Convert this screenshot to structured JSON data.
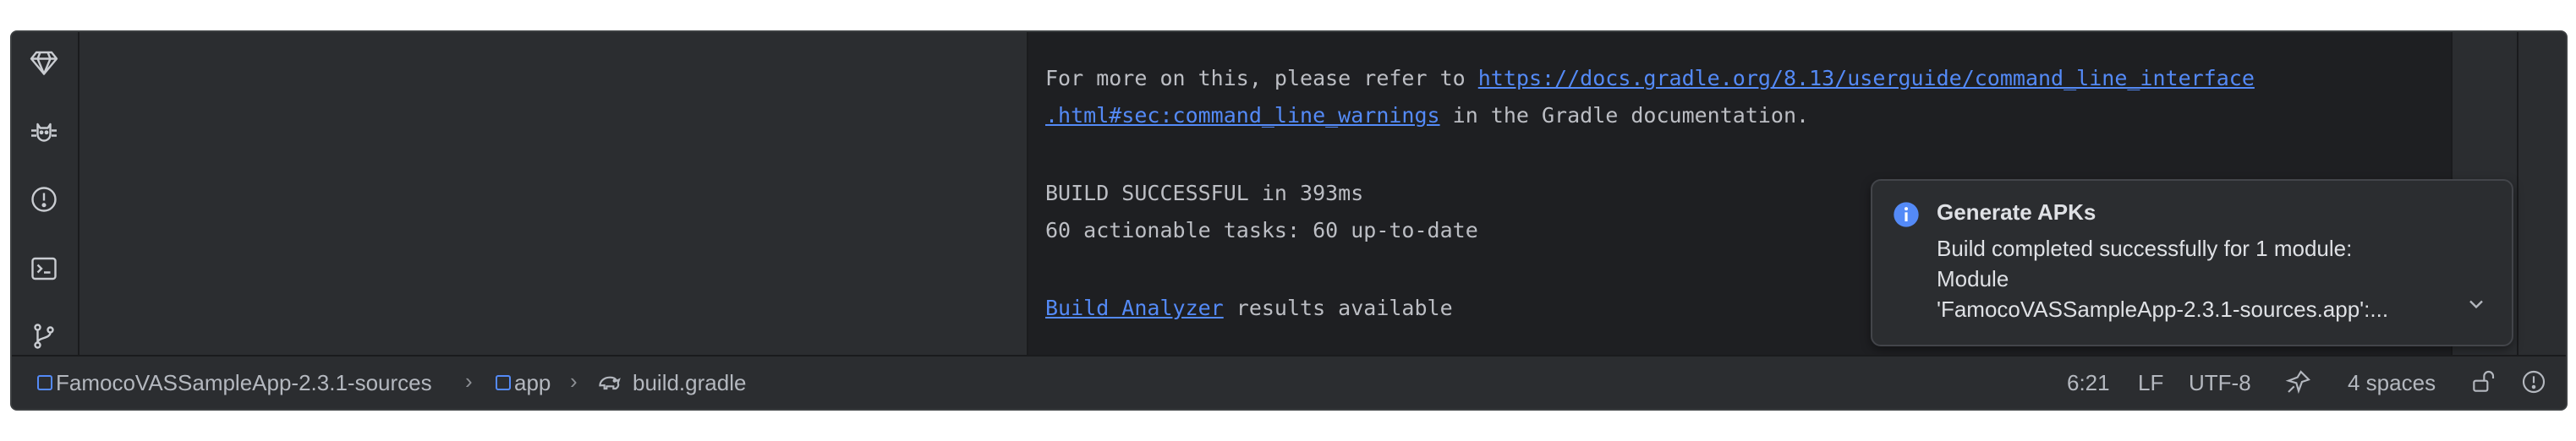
{
  "tool_strip_icons": [
    "gem-icon",
    "cat-icon",
    "problems-icon",
    "terminal-icon",
    "git-branch-icon"
  ],
  "console": {
    "line1_prefix": "For more on this, please refer to ",
    "line1_link": "https://docs.gradle.org/8.13/userguide/command_line_interface",
    "line2_link": ".html#sec:command_line_warnings",
    "line2_suffix": " in the Gradle documentation.",
    "build_status": "BUILD SUCCESSFUL in 393ms",
    "tasks": "60 actionable tasks: 60 up-to-date",
    "analyzer_link": "Build Analyzer",
    "analyzer_suffix": " results available"
  },
  "notification": {
    "title": "Generate APKs",
    "line1": "Build completed successfully for 1 module:",
    "line2": "Module",
    "line3": "'FamocoVASSampleApp-2.3.1-sources.app':...",
    "icon": "info-icon"
  },
  "statusbar": {
    "breadcrumb": {
      "project": "FamocoVASSampleApp-2.3.1-sources",
      "module": "app",
      "file": "build.gradle"
    },
    "position": "6:21",
    "line_ending": "LF",
    "encoding": "UTF-8",
    "indent": "4 spaces"
  },
  "colors": {
    "link": "#548af7",
    "background": "#1e1f22",
    "panel": "#2b2d30"
  }
}
